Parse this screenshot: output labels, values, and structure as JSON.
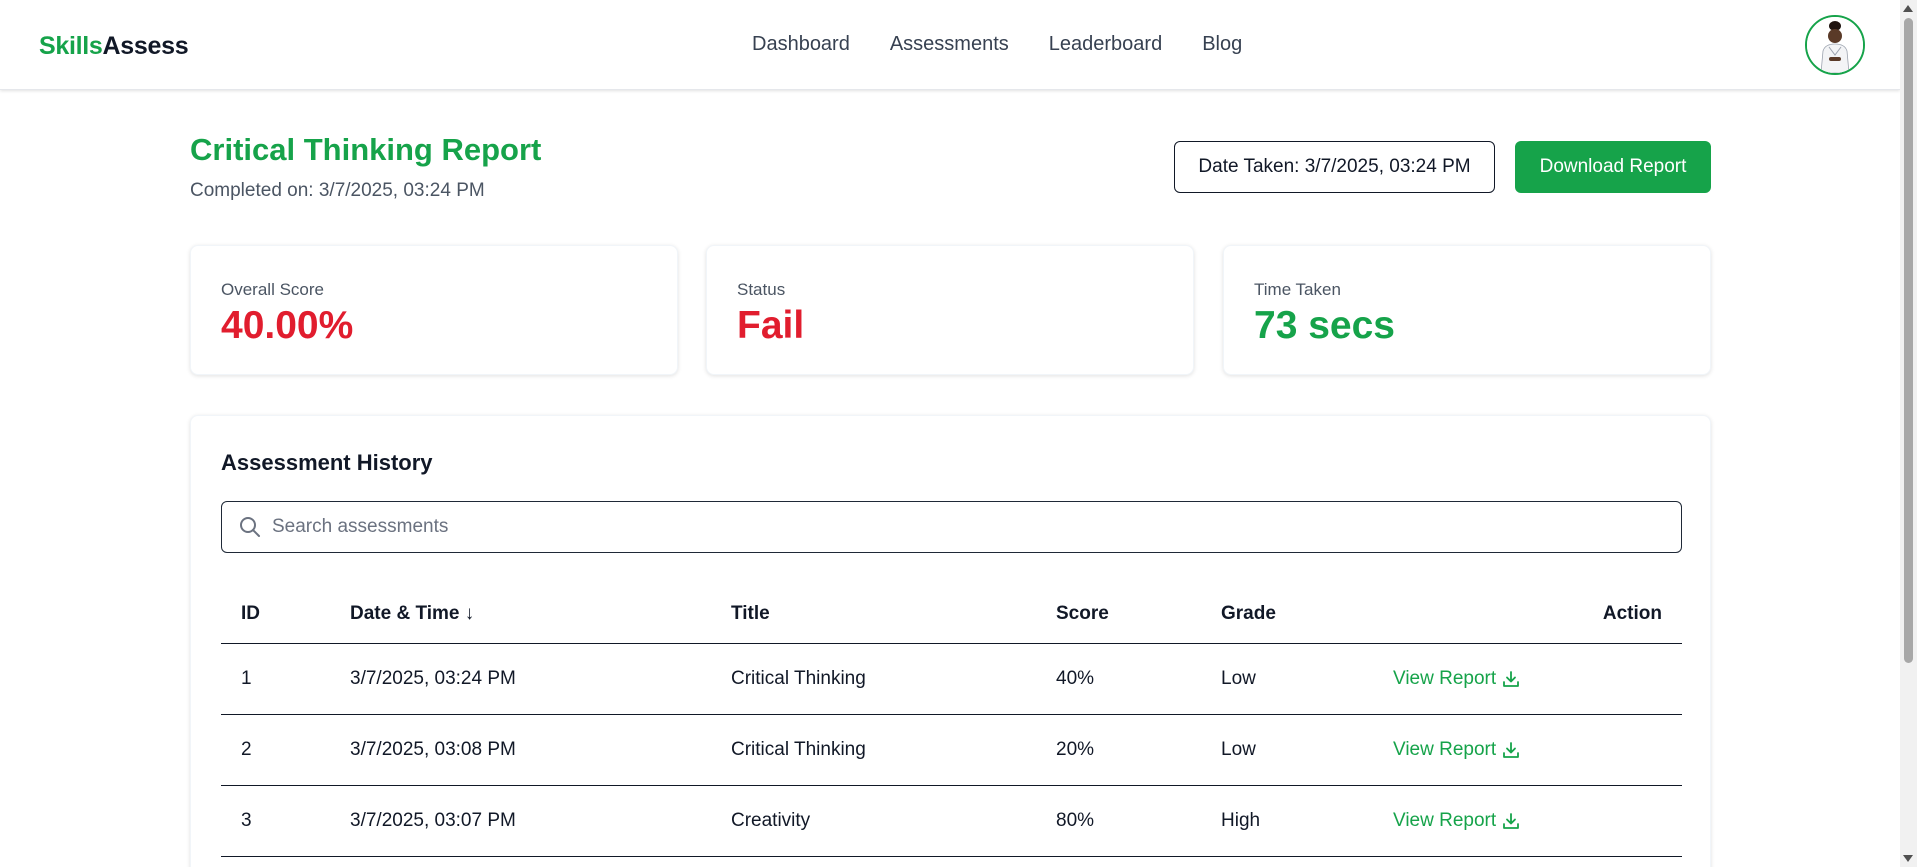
{
  "brand": {
    "part1": "Skills",
    "part2": "Assess"
  },
  "nav": {
    "items": [
      "Dashboard",
      "Assessments",
      "Leaderboard",
      "Blog"
    ]
  },
  "header": {
    "title": "Critical Thinking Report",
    "completed": "Completed on: 3/7/2025, 03:24 PM",
    "date_taken": "Date Taken: 3/7/2025, 03:24 PM",
    "download_label": "Download Report"
  },
  "stats": [
    {
      "label": "Overall Score",
      "value": "40.00%",
      "color": "#e11d2e"
    },
    {
      "label": "Status",
      "value": "Fail",
      "color": "#e11d2e"
    },
    {
      "label": "Time Taken",
      "value": "73 secs",
      "color": "#16a34a"
    }
  ],
  "history": {
    "title": "Assessment History",
    "search_placeholder": "Search assessments",
    "columns": {
      "id": "ID",
      "date": "Date & Time ↓",
      "title": "Title",
      "score": "Score",
      "grade": "Grade",
      "action": "Action"
    },
    "rows": [
      {
        "id": "1",
        "date": "3/7/2025, 03:24 PM",
        "title": "Critical Thinking",
        "score": "40%",
        "grade": "Low",
        "action": "View Report"
      },
      {
        "id": "2",
        "date": "3/7/2025, 03:08 PM",
        "title": "Critical Thinking",
        "score": "20%",
        "grade": "Low",
        "action": "View Report"
      },
      {
        "id": "3",
        "date": "3/7/2025, 03:07 PM",
        "title": "Creativity",
        "score": "80%",
        "grade": "High",
        "action": "View Report"
      }
    ]
  },
  "theme": {
    "accent": "#16a34a",
    "danger": "#e11d2e"
  }
}
